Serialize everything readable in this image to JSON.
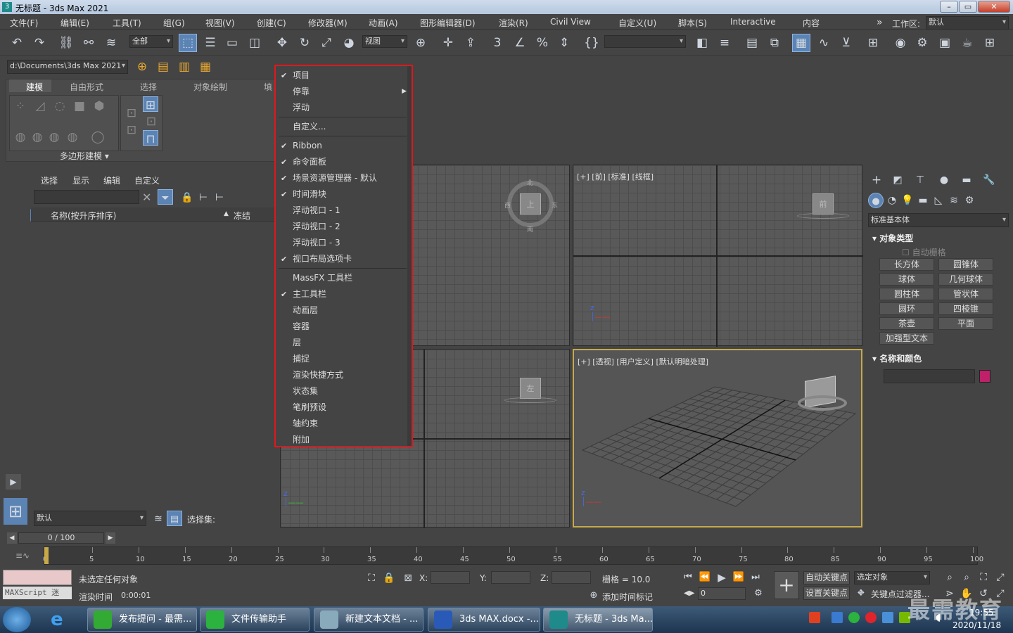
{
  "window": {
    "title": "无标题 - 3ds Max 2021",
    "min": "–",
    "max": "▭",
    "close": "✕"
  },
  "menubar": [
    "文件(F)",
    "编辑(E)",
    "工具(T)",
    "组(G)",
    "视图(V)",
    "创建(C)",
    "修改器(M)",
    "动画(A)",
    "图形编辑器(D)",
    "渲染(R)",
    "Civil View",
    "自定义(U)",
    "脚本(S)",
    "Interactive",
    "内容"
  ],
  "workspace": {
    "label": "工作区:",
    "value": "默认",
    "expand": "»"
  },
  "toolbar": {
    "filter": "全部",
    "refcoord": "视图",
    "path": "d:\\Documents\\3ds Max 2021"
  },
  "ribbon": {
    "tabs": [
      "建模",
      "自由形式",
      "选择",
      "对象绘制",
      "填"
    ],
    "group": "多边形建模 ▾"
  },
  "explorer": {
    "tabs": [
      "选择",
      "显示",
      "编辑",
      "自定义"
    ],
    "column_name": "名称(按升序排序)",
    "column_freeze": "冻结",
    "layer": "默认",
    "selset": "选择集:"
  },
  "context_menu": {
    "items": [
      {
        "label": "项目",
        "checked": true
      },
      {
        "label": "停靠",
        "checked": false,
        "submenu": true
      },
      {
        "label": "浮动",
        "checked": false
      },
      {
        "label": "自定义...",
        "checked": false,
        "sep_before": true
      },
      {
        "label": "Ribbon",
        "checked": true,
        "sep_before": true
      },
      {
        "label": "命令面板",
        "checked": true
      },
      {
        "label": "场景资源管理器 - 默认",
        "checked": true
      },
      {
        "label": "时间滑块",
        "checked": true
      },
      {
        "label": "浮动视口 - 1",
        "checked": false
      },
      {
        "label": "浮动视口 - 2",
        "checked": false
      },
      {
        "label": "浮动视口 - 3",
        "checked": false
      },
      {
        "label": "视口布局选项卡",
        "checked": true
      },
      {
        "label": "MassFX 工具栏",
        "checked": false,
        "sep_before": true
      },
      {
        "label": "主工具栏",
        "checked": true
      },
      {
        "label": "动画层",
        "checked": false
      },
      {
        "label": "容器",
        "checked": false
      },
      {
        "label": "层",
        "checked": false
      },
      {
        "label": "捕捉",
        "checked": false
      },
      {
        "label": "渲染快捷方式",
        "checked": false
      },
      {
        "label": "状态集",
        "checked": false
      },
      {
        "label": "笔刷预设",
        "checked": false
      },
      {
        "label": "轴约束",
        "checked": false
      },
      {
        "label": "附加",
        "checked": false
      }
    ],
    "check_glyph": "✔",
    "submenu_glyph": "▶"
  },
  "viewports": {
    "front": "[+] [前] [标准] [线框]",
    "persp": "[+] [透视] [用户定义] [默认明暗处理]",
    "cube_top": "上",
    "cube_front": "前",
    "cube_left": "左",
    "compass": {
      "n": "北",
      "s": "南",
      "w": "西",
      "e": "东"
    }
  },
  "command_panel": {
    "dropdown": "标准基本体",
    "rollout1": "对象类型",
    "autogrid": "自动栅格",
    "buttons": [
      "长方体",
      "圆锥体",
      "球体",
      "几何球体",
      "圆柱体",
      "管状体",
      "圆环",
      "四棱锥",
      "茶壶",
      "平面",
      "加强型文本"
    ],
    "rollout2": "名称和颜色",
    "color": "#c0206a"
  },
  "timeline": {
    "frame": "0 / 100",
    "ticks": [
      "0",
      "5",
      "10",
      "15",
      "20",
      "25",
      "30",
      "35",
      "40",
      "45",
      "50",
      "55",
      "60",
      "65",
      "70",
      "75",
      "80",
      "85",
      "90",
      "95",
      "100"
    ]
  },
  "status": {
    "maxscript": "MAXScript 迷",
    "no_selection": "未选定任何对象",
    "render_time_label": "渲染时间",
    "render_time": "0:00:01",
    "x": "X:",
    "y": "Y:",
    "z": "Z:",
    "grid": "栅格 = 10.0",
    "add_time_tag": "添加时间标记",
    "autokey": "自动关键点",
    "setkey": "设置关键点",
    "selected": "选定对象",
    "keyfilter": "关键点过滤器...",
    "frame_field": "0"
  },
  "taskbar": {
    "tasks": [
      "发布提问 - 最需...",
      "文件传输助手",
      "新建文本文档 - ...",
      "3ds MAX.docx -...",
      "无标题 - 3ds Ma..."
    ],
    "date": "2020/11/18",
    "time": "19:55",
    "watermark": "最需教育"
  }
}
